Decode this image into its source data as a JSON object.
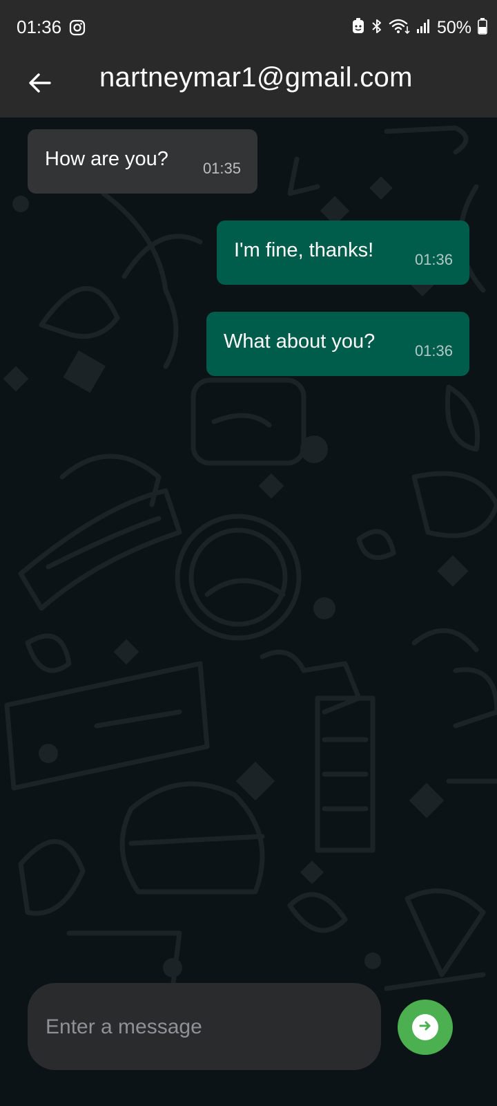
{
  "status_bar": {
    "time": "01:36",
    "battery_percent": "50%",
    "icons": [
      "instagram-icon",
      "android-icon",
      "bluetooth-icon",
      "wifi-icon",
      "signal-icon",
      "battery-icon"
    ]
  },
  "header": {
    "title": "nartneymar1@gmail.com",
    "back_icon": "arrow-left-icon"
  },
  "messages": [
    {
      "direction": "incoming",
      "text": "How are you?",
      "time": "01:35"
    },
    {
      "direction": "outgoing",
      "text": "I'm fine, thanks!",
      "time": "01:36"
    },
    {
      "direction": "outgoing",
      "text": "What about you?",
      "time": "01:36"
    }
  ],
  "composer": {
    "placeholder": "Enter a message",
    "value": "",
    "send_icon": "arrow-right-icon"
  },
  "colors": {
    "app_bar": "#2a2a2a",
    "chat_background": "#0c1317",
    "incoming_bubble": "#333436",
    "outgoing_bubble": "#005c4b",
    "send_button": "#4caf50"
  }
}
